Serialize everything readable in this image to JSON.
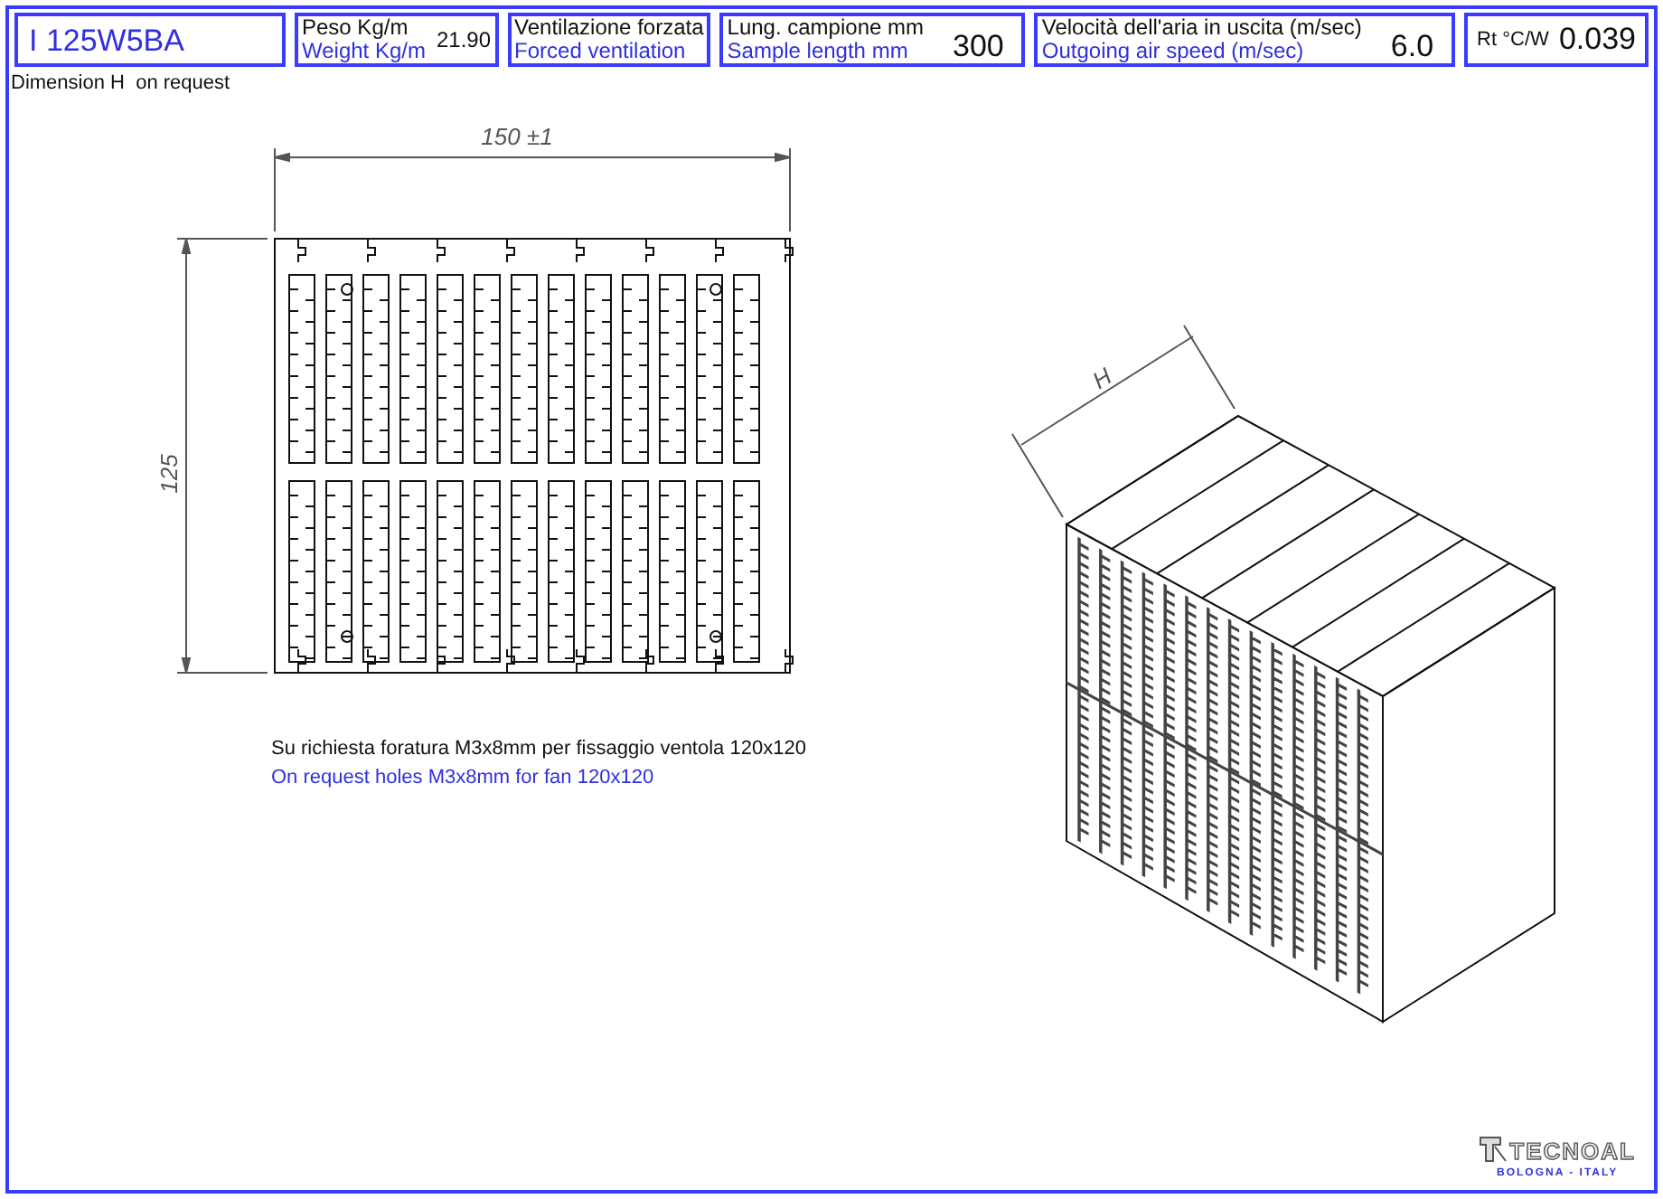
{
  "part_code": "I 125W5BA",
  "specs": [
    {
      "label_it": "Peso Kg/m",
      "label_en": "Weight Kg/m",
      "value": "21.90",
      "kind": "compact"
    },
    {
      "label_it": "Ventilazione forzata",
      "label_en": "Forced ventilation"
    },
    {
      "label_it": "Lung. campione mm",
      "label_en": "Sample length mm",
      "value": "300",
      "kind": "wide"
    },
    {
      "label_it": "Velocità dell'aria in uscita (m/sec)",
      "label_en": "Outgoing air speed (m/sec)",
      "value": "6.0",
      "kind": "wide"
    }
  ],
  "rt": {
    "label": "Rt °C/W",
    "value": "0.039"
  },
  "note": "Dimension H  on request",
  "drawing": {
    "width_dim": "150 ±1",
    "height_dim": "125",
    "depth_dim": "H"
  },
  "remark_it": "Su richiesta foratura M3x8mm per fissaggio ventola 120x120",
  "remark_en": "On request holes M3x8mm for fan 120x120",
  "logo": {
    "name": "TECNOAL",
    "place": "BOLOGNA - ITALY"
  }
}
